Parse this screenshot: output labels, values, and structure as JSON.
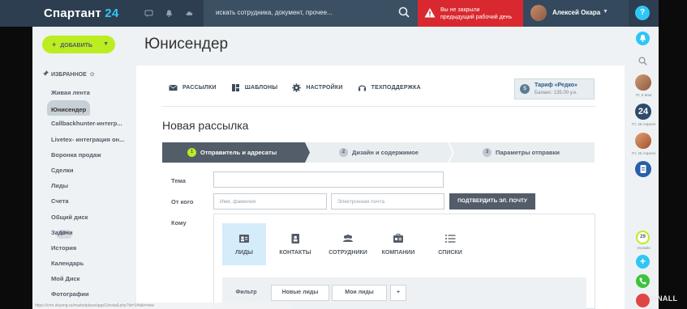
{
  "topbar": {
    "logo_name": "Спартант",
    "logo_num": "24",
    "search_placeholder": "искать сотрудника, документ, прочее...",
    "alert_line1": "Вы не закрыли",
    "alert_line2": "предыдущий рабочий день",
    "user_name": "Алексей Окара",
    "help": "?"
  },
  "sidebar": {
    "add_label": "ДОБАВИТЬ",
    "favorites_label": "ИЗБРАННОЕ",
    "items": [
      {
        "label": "Живая лента"
      },
      {
        "label": "Юнисендер",
        "active": true
      },
      {
        "label": "Callbackhunter-интегр..."
      },
      {
        "label": "Livetex- интеграция он..."
      },
      {
        "label": "Воронка продаж"
      },
      {
        "label": "Сделки"
      },
      {
        "label": "Лиды"
      },
      {
        "label": "Счета"
      },
      {
        "label": "Общий диск"
      },
      {
        "label": "Задачи",
        "badge": "50+"
      },
      {
        "label": "История"
      },
      {
        "label": "Календарь"
      },
      {
        "label": "Мой Диск"
      },
      {
        "label": "Фотографии"
      }
    ]
  },
  "page": {
    "title": "Юнисендер",
    "subnav": [
      "РАССЫЛКИ",
      "ШАБЛОНЫ",
      "НАСТРОЙКИ",
      "ТЕХПОДДЕРЖКА"
    ],
    "tariff_title": "Тариф «Редко»",
    "tariff_balance": "Баланс: 135.00 у.е.",
    "tariff_circle": "$",
    "heading": "Новая рассылка",
    "steps": [
      {
        "num": "1",
        "label": "Отправитель и адресаты"
      },
      {
        "num": "2",
        "label": "Дизайн и содержимое"
      },
      {
        "num": "3",
        "label": "Параметры отправки"
      }
    ],
    "form": {
      "subject_label": "Тема",
      "from_label": "От кого",
      "name_placeholder": "Имя, фамилия",
      "email_placeholder": "Электронная почта",
      "confirm_label": "ПОДТВЕРДИТЬ ЭЛ. ПОЧТУ",
      "to_label": "Кому"
    },
    "recipient_tabs": [
      "ЛИДЫ",
      "КОНТАКТЫ",
      "СОТРУДНИКИ",
      "КОМПАНИИ",
      "СПИСКИ"
    ],
    "filter_tabs": [
      "Фильтр",
      "Новые лиды",
      "Мои лиды",
      "+"
    ]
  },
  "rail": {
    "date1": "Пт, 6 Мая",
    "date2": "Пт, 26 Апреля",
    "date3": "Пт, 25 Апреля",
    "count24": "24",
    "online_num": "29",
    "online_label": "Онлайн"
  },
  "watermark": "PINALL",
  "status_url": "https://crm.skyeng.ru/marketplace/app/1/install.php?id=3#tab=new",
  "colors": {
    "accent": "#2fc6f6",
    "add_button": "#bbed21",
    "alert": "#d9282f",
    "topbar": "#2c3e50"
  }
}
